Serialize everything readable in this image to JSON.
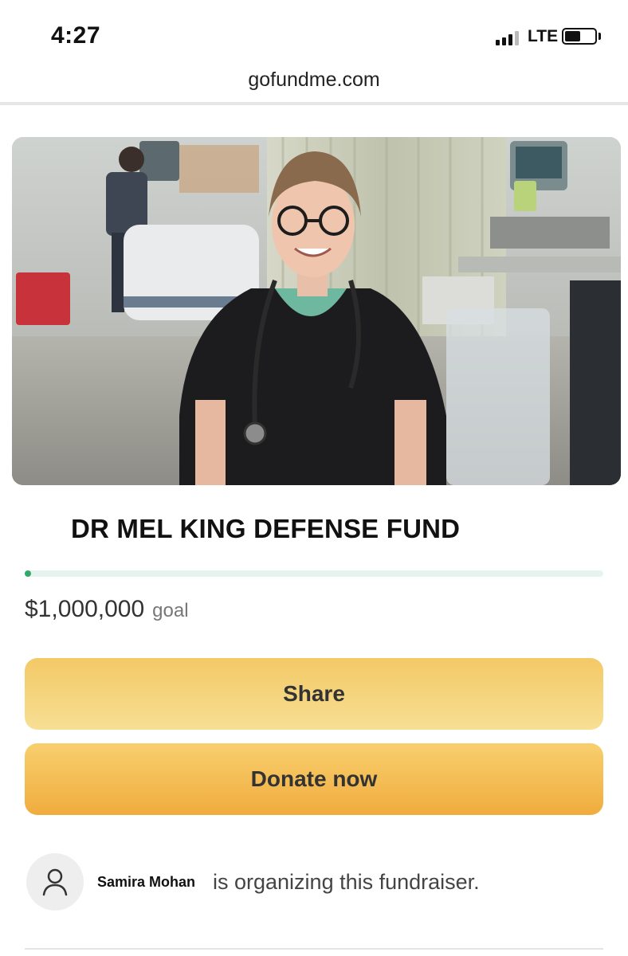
{
  "status_bar": {
    "time": "4:27",
    "network": "LTE",
    "icons": [
      "cellular-signal-icon",
      "battery-icon"
    ]
  },
  "browser": {
    "url": "gofundme.com"
  },
  "hero": {
    "icon": "hero-photo"
  },
  "fundraiser": {
    "title": "DR MEL KING DEFENSE FUND",
    "progress_fraction": 0.0,
    "goal_amount": "$1,000,000",
    "goal_label": "goal"
  },
  "actions": {
    "share_label": "Share",
    "donate_label": "Donate now"
  },
  "organizer": {
    "name": "Samira Mohan",
    "text": "is organizing this fundraiser.",
    "avatar_icon": "user-icon"
  },
  "colors": {
    "progress": "#2faa6a",
    "progress_track": "#e6f3ee",
    "share_button": "#f5d47e",
    "donate_button": "#f4bd55"
  }
}
